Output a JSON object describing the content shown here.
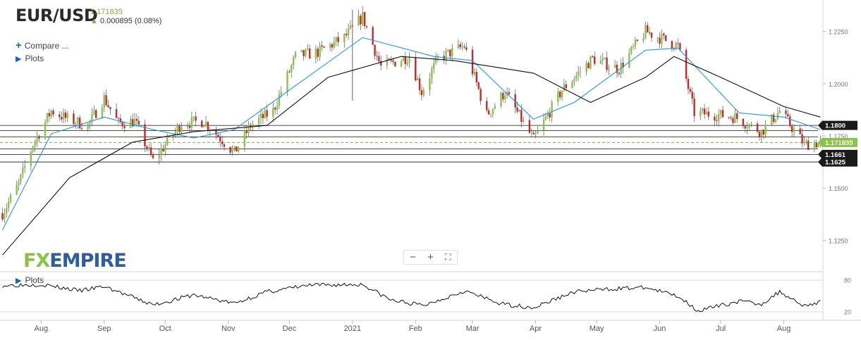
{
  "header": {
    "symbol": "EUR/USD",
    "price": "1.171835",
    "change": "0.000895 (0.08%)",
    "change_arrow_icon": "arrow-up-icon"
  },
  "menu": {
    "compare_label": "Compare ...",
    "plots_label": "Plots",
    "sub_plots_label": "Plots"
  },
  "logo": {
    "part1": "FX",
    "part2": "EMPIRE"
  },
  "zoom_controls": {
    "minus": "−",
    "plus": "+",
    "fit": "⛶"
  },
  "colors": {
    "up": "#8bc34a",
    "down": "#c62828",
    "ema_fast": "#2196f3",
    "sma_slow": "#111111",
    "price_tag": "#8bc34a"
  },
  "chart_data": {
    "type": "line",
    "title": "EUR/USD",
    "xlim": [
      "2020-07-13",
      "2021-08-19"
    ],
    "ylim": [
      1.11,
      1.24
    ],
    "x_tick_labels": [
      "Aug",
      "Sep",
      "Oct",
      "Nov",
      "Dec",
      "2021",
      "Feb",
      "Mar",
      "Apr",
      "May",
      "Jun",
      "Jul",
      "Aug"
    ],
    "x_tick_dates": [
      "2020-08-01",
      "2020-09-01",
      "2020-10-01",
      "2020-11-01",
      "2020-12-01",
      "2021-01-01",
      "2021-02-01",
      "2021-03-01",
      "2021-04-01",
      "2021-05-01",
      "2021-06-01",
      "2021-07-01",
      "2021-08-01"
    ],
    "y_tick_labels": [
      "1.2250",
      "1.2000",
      "1.1750",
      "1.1500",
      "1.1250"
    ],
    "y_tick_values": [
      1.225,
      1.2,
      1.175,
      1.15,
      1.125
    ],
    "candles_note": "daily candlesticks",
    "close_path": [
      {
        "d": "2020-07-13",
        "v": 1.138
      },
      {
        "d": "2020-07-21",
        "v": 1.152
      },
      {
        "d": "2020-07-28",
        "v": 1.171
      },
      {
        "d": "2020-08-06",
        "v": 1.187
      },
      {
        "d": "2020-08-14",
        "v": 1.183
      },
      {
        "d": "2020-08-24",
        "v": 1.18
      },
      {
        "d": "2020-09-01",
        "v": 1.193
      },
      {
        "d": "2020-09-08",
        "v": 1.181
      },
      {
        "d": "2020-09-16",
        "v": 1.182
      },
      {
        "d": "2020-09-25",
        "v": 1.163
      },
      {
        "d": "2020-10-09",
        "v": 1.181
      },
      {
        "d": "2020-10-20",
        "v": 1.182
      },
      {
        "d": "2020-11-04",
        "v": 1.167
      },
      {
        "d": "2020-11-12",
        "v": 1.18
      },
      {
        "d": "2020-11-23",
        "v": 1.187
      },
      {
        "d": "2020-12-04",
        "v": 1.213
      },
      {
        "d": "2020-12-15",
        "v": 1.215
      },
      {
        "d": "2020-12-28",
        "v": 1.222
      },
      {
        "d": "2021-01-06",
        "v": 1.232
      },
      {
        "d": "2021-01-15",
        "v": 1.208
      },
      {
        "d": "2021-01-29",
        "v": 1.213
      },
      {
        "d": "2021-02-04",
        "v": 1.196
      },
      {
        "d": "2021-02-12",
        "v": 1.212
      },
      {
        "d": "2021-02-25",
        "v": 1.218
      },
      {
        "d": "2021-03-08",
        "v": 1.185
      },
      {
        "d": "2021-03-17",
        "v": 1.196
      },
      {
        "d": "2021-03-31",
        "v": 1.173
      },
      {
        "d": "2021-04-14",
        "v": 1.197
      },
      {
        "d": "2021-04-29",
        "v": 1.212
      },
      {
        "d": "2021-05-12",
        "v": 1.207
      },
      {
        "d": "2021-05-25",
        "v": 1.225
      },
      {
        "d": "2021-06-10",
        "v": 1.218
      },
      {
        "d": "2021-06-18",
        "v": 1.186
      },
      {
        "d": "2021-06-30",
        "v": 1.185
      },
      {
        "d": "2021-07-08",
        "v": 1.184
      },
      {
        "d": "2021-07-21",
        "v": 1.177
      },
      {
        "d": "2021-07-30",
        "v": 1.187
      },
      {
        "d": "2021-08-11",
        "v": 1.171
      },
      {
        "d": "2021-08-19",
        "v": 1.1718
      }
    ],
    "series": [
      {
        "kind": "ema_fast",
        "points": [
          {
            "d": "2020-07-13",
            "v": 1.13
          },
          {
            "d": "2020-08-06",
            "v": 1.176
          },
          {
            "d": "2020-09-01",
            "v": 1.184
          },
          {
            "d": "2020-09-25",
            "v": 1.178
          },
          {
            "d": "2020-10-15",
            "v": 1.174
          },
          {
            "d": "2020-11-04",
            "v": 1.178
          },
          {
            "d": "2020-12-04",
            "v": 1.199
          },
          {
            "d": "2021-01-06",
            "v": 1.222
          },
          {
            "d": "2021-02-10",
            "v": 1.213
          },
          {
            "d": "2021-03-01",
            "v": 1.211
          },
          {
            "d": "2021-03-31",
            "v": 1.183
          },
          {
            "d": "2021-04-20",
            "v": 1.191
          },
          {
            "d": "2021-05-25",
            "v": 1.216
          },
          {
            "d": "2021-06-10",
            "v": 1.217
          },
          {
            "d": "2021-07-10",
            "v": 1.186
          },
          {
            "d": "2021-08-01",
            "v": 1.184
          },
          {
            "d": "2021-08-19",
            "v": 1.178
          }
        ]
      },
      {
        "kind": "sma_slow",
        "points": [
          {
            "d": "2020-07-13",
            "v": 1.118
          },
          {
            "d": "2020-08-15",
            "v": 1.155
          },
          {
            "d": "2020-09-15",
            "v": 1.172
          },
          {
            "d": "2020-10-15",
            "v": 1.177
          },
          {
            "d": "2020-11-20",
            "v": 1.18
          },
          {
            "d": "2020-12-20",
            "v": 1.203
          },
          {
            "d": "2021-01-25",
            "v": 1.213
          },
          {
            "d": "2021-02-20",
            "v": 1.211
          },
          {
            "d": "2021-03-31",
            "v": 1.205
          },
          {
            "d": "2021-04-28",
            "v": 1.191
          },
          {
            "d": "2021-05-25",
            "v": 1.203
          },
          {
            "d": "2021-06-08",
            "v": 1.213
          },
          {
            "d": "2021-07-01",
            "v": 1.203
          },
          {
            "d": "2021-08-01",
            "v": 1.189
          },
          {
            "d": "2021-08-19",
            "v": 1.184
          }
        ]
      }
    ],
    "horizontal_levels": [
      1.18,
      1.1775,
      1.1745,
      1.171835,
      1.1688,
      1.1661,
      1.1625
    ],
    "level_tags": [
      {
        "value": 1.18,
        "label": "1.1800"
      },
      {
        "value": 1.171835,
        "label": "1.171835"
      },
      {
        "value": 1.1661,
        "label": "1.1661"
      },
      {
        "value": 1.1625,
        "label": "1.1625"
      }
    ],
    "rsi": {
      "ylim": [
        0,
        100
      ],
      "y_tick_labels": [
        "80",
        "20"
      ],
      "y_tick_values": [
        80,
        20
      ],
      "points": [
        {
          "d": "2020-07-13",
          "v": 70
        },
        {
          "d": "2020-08-01",
          "v": 72
        },
        {
          "d": "2020-08-20",
          "v": 60
        },
        {
          "d": "2020-09-01",
          "v": 68
        },
        {
          "d": "2020-09-25",
          "v": 33
        },
        {
          "d": "2020-10-15",
          "v": 52
        },
        {
          "d": "2020-11-04",
          "v": 36
        },
        {
          "d": "2020-11-20",
          "v": 58
        },
        {
          "d": "2020-12-10",
          "v": 70
        },
        {
          "d": "2021-01-06",
          "v": 72
        },
        {
          "d": "2021-01-20",
          "v": 42
        },
        {
          "d": "2021-02-05",
          "v": 32
        },
        {
          "d": "2021-02-25",
          "v": 60
        },
        {
          "d": "2021-03-15",
          "v": 35
        },
        {
          "d": "2021-03-31",
          "v": 28
        },
        {
          "d": "2021-04-20",
          "v": 58
        },
        {
          "d": "2021-05-10",
          "v": 64
        },
        {
          "d": "2021-05-25",
          "v": 66
        },
        {
          "d": "2021-06-10",
          "v": 50
        },
        {
          "d": "2021-06-20",
          "v": 22
        },
        {
          "d": "2021-07-10",
          "v": 40
        },
        {
          "d": "2021-07-21",
          "v": 35
        },
        {
          "d": "2021-07-30",
          "v": 58
        },
        {
          "d": "2021-08-11",
          "v": 32
        },
        {
          "d": "2021-08-19",
          "v": 38
        }
      ]
    }
  }
}
